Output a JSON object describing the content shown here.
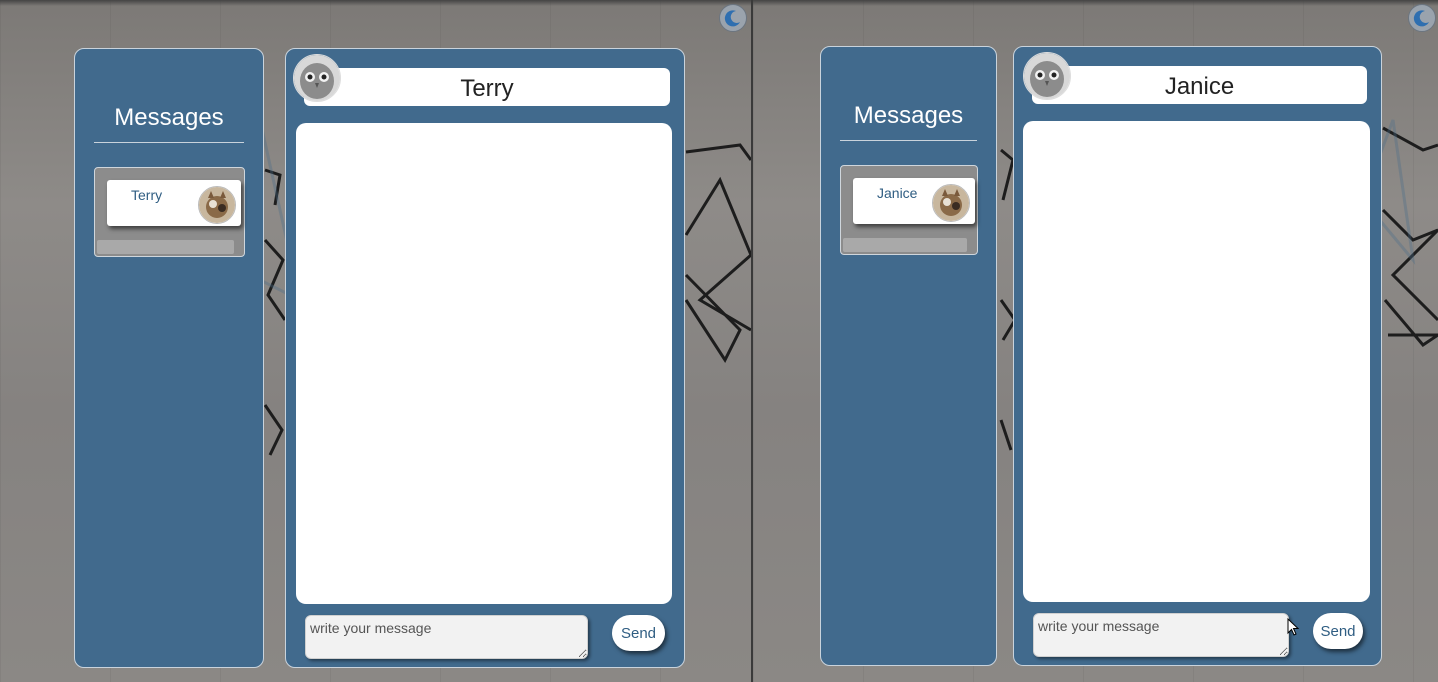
{
  "panes": [
    {
      "sidebar": {
        "title": "Messages"
      },
      "conversations": [
        {
          "name": "Terry",
          "avatar_icon": "cat-avatar-icon"
        }
      ],
      "chat": {
        "contact_name": "Terry",
        "avatar_icon": "owl-avatar-icon",
        "input_placeholder": "write your message",
        "send_label": "Send"
      },
      "theme_toggle_icon": "moon-icon"
    },
    {
      "sidebar": {
        "title": "Messages"
      },
      "conversations": [
        {
          "name": "Janice",
          "avatar_icon": "cat-avatar-icon"
        }
      ],
      "chat": {
        "contact_name": "Janice",
        "avatar_icon": "owl-avatar-icon",
        "input_placeholder": "write your message",
        "send_label": "Send"
      },
      "theme_toggle_icon": "moon-icon"
    }
  ],
  "colors": {
    "panel_blue": "#416a8d",
    "panel_border": "#c9d3dc",
    "accent_text": "#2f5d82",
    "background_concrete": "#8a8785"
  }
}
